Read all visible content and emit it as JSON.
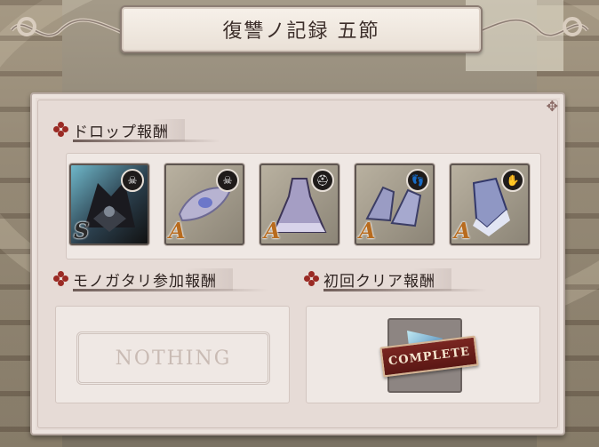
{
  "header": {
    "title": "復讐ノ記録 五節"
  },
  "drop_rewards": {
    "label": "ドロップ報酬",
    "items": [
      {
        "rank": "S",
        "type_icon": "skull-icon",
        "art": "dark-armor-creature",
        "color": "#3a4f60"
      },
      {
        "rank": "A",
        "type_icon": "skull-icon",
        "art": "ornate-amulet",
        "color": "#a7a0b8"
      },
      {
        "rank": "A",
        "type_icon": "helmet-icon",
        "art": "lace-dress",
        "color": "#9a92b0"
      },
      {
        "rank": "A",
        "type_icon": "boot-icon",
        "art": "ornate-heels",
        "color": "#8f93b2"
      },
      {
        "rank": "A",
        "type_icon": "glove-icon",
        "art": "frilled-gauntlet",
        "color": "#9aa0bc"
      }
    ]
  },
  "story_rewards": {
    "label": "モノガタリ参加報酬",
    "value": "NOTHING"
  },
  "first_clear_rewards": {
    "label": "初回クリア報酬",
    "badge": "COMPLETE"
  },
  "colors": {
    "accent": "#9a2a24",
    "panel": "#e6dbd6"
  }
}
